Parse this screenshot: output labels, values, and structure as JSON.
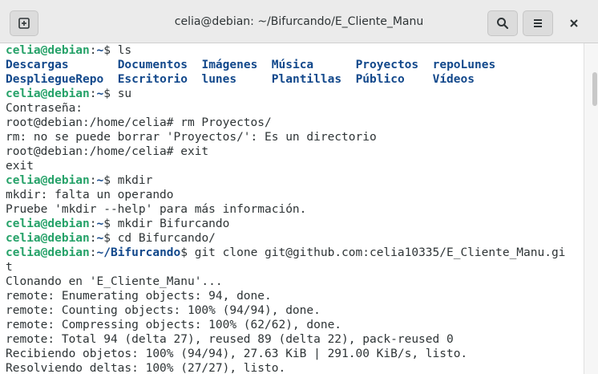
{
  "window": {
    "title": "celia@debian: ~/Bifurcando/E_Cliente_Manu",
    "icons": {
      "new_tab": "new-tab-icon",
      "search": "search-icon",
      "menu": "hamburger-menu-icon",
      "close": "close-icon"
    }
  },
  "colors": {
    "user_prompt": "#26a269",
    "path_prompt": "#12488b",
    "directory": "#12488b",
    "text": "#2e3436"
  },
  "terminal": {
    "lines": [
      [
        {
          "t": "celia@debian",
          "c": "user"
        },
        {
          "t": ":"
        },
        {
          "t": "~",
          "c": "path"
        },
        {
          "t": "$ ls"
        }
      ],
      [
        {
          "t": "Descargas",
          "c": "dir"
        },
        {
          "t": "       "
        },
        {
          "t": "Documentos",
          "c": "dir"
        },
        {
          "t": "  "
        },
        {
          "t": "Imágenes",
          "c": "dir"
        },
        {
          "t": "  "
        },
        {
          "t": "Música",
          "c": "dir"
        },
        {
          "t": "      "
        },
        {
          "t": "Proyectos",
          "c": "dir"
        },
        {
          "t": "  "
        },
        {
          "t": "repoLunes",
          "c": "dir"
        }
      ],
      [
        {
          "t": "DespliegueRepo",
          "c": "dir"
        },
        {
          "t": "  "
        },
        {
          "t": "Escritorio",
          "c": "dir"
        },
        {
          "t": "  "
        },
        {
          "t": "lunes",
          "c": "dir"
        },
        {
          "t": "     "
        },
        {
          "t": "Plantillas",
          "c": "dir"
        },
        {
          "t": "  "
        },
        {
          "t": "Público",
          "c": "dir"
        },
        {
          "t": "    "
        },
        {
          "t": "Vídeos",
          "c": "dir"
        }
      ],
      [
        {
          "t": "celia@debian",
          "c": "user"
        },
        {
          "t": ":"
        },
        {
          "t": "~",
          "c": "path"
        },
        {
          "t": "$ su"
        }
      ],
      [
        {
          "t": "Contraseña:"
        }
      ],
      [
        {
          "t": "root@debian:/home/celia# rm Proyectos/"
        }
      ],
      [
        {
          "t": "rm: no se puede borrar 'Proyectos/': Es un directorio"
        }
      ],
      [
        {
          "t": "root@debian:/home/celia# exit"
        }
      ],
      [
        {
          "t": "exit"
        }
      ],
      [
        {
          "t": "celia@debian",
          "c": "user"
        },
        {
          "t": ":"
        },
        {
          "t": "~",
          "c": "path"
        },
        {
          "t": "$ mkdir"
        }
      ],
      [
        {
          "t": "mkdir: falta un operando"
        }
      ],
      [
        {
          "t": "Pruebe 'mkdir --help' para más información."
        }
      ],
      [
        {
          "t": "celia@debian",
          "c": "user"
        },
        {
          "t": ":"
        },
        {
          "t": "~",
          "c": "path"
        },
        {
          "t": "$ mkdir Bifurcando"
        }
      ],
      [
        {
          "t": "celia@debian",
          "c": "user"
        },
        {
          "t": ":"
        },
        {
          "t": "~",
          "c": "path"
        },
        {
          "t": "$ cd Bifurcando/"
        }
      ],
      [
        {
          "t": "celia@debian",
          "c": "user"
        },
        {
          "t": ":"
        },
        {
          "t": "~/Bifurcando",
          "c": "path"
        },
        {
          "t": "$ git clone git@github.com:celia10335/E_Cliente_Manu.gi"
        }
      ],
      [
        {
          "t": "t"
        }
      ],
      [
        {
          "t": "Clonando en 'E_Cliente_Manu'..."
        }
      ],
      [
        {
          "t": "remote: Enumerating objects: 94, done."
        }
      ],
      [
        {
          "t": "remote: Counting objects: 100% (94/94), done."
        }
      ],
      [
        {
          "t": "remote: Compressing objects: 100% (62/62), done."
        }
      ],
      [
        {
          "t": "remote: Total 94 (delta 27), reused 89 (delta 22), pack-reused 0"
        }
      ],
      [
        {
          "t": "Recibiendo objetos: 100% (94/94), 27.63 KiB | 291.00 KiB/s, listo."
        }
      ],
      [
        {
          "t": "Resolviendo deltas: 100% (27/27), listo."
        }
      ]
    ]
  }
}
